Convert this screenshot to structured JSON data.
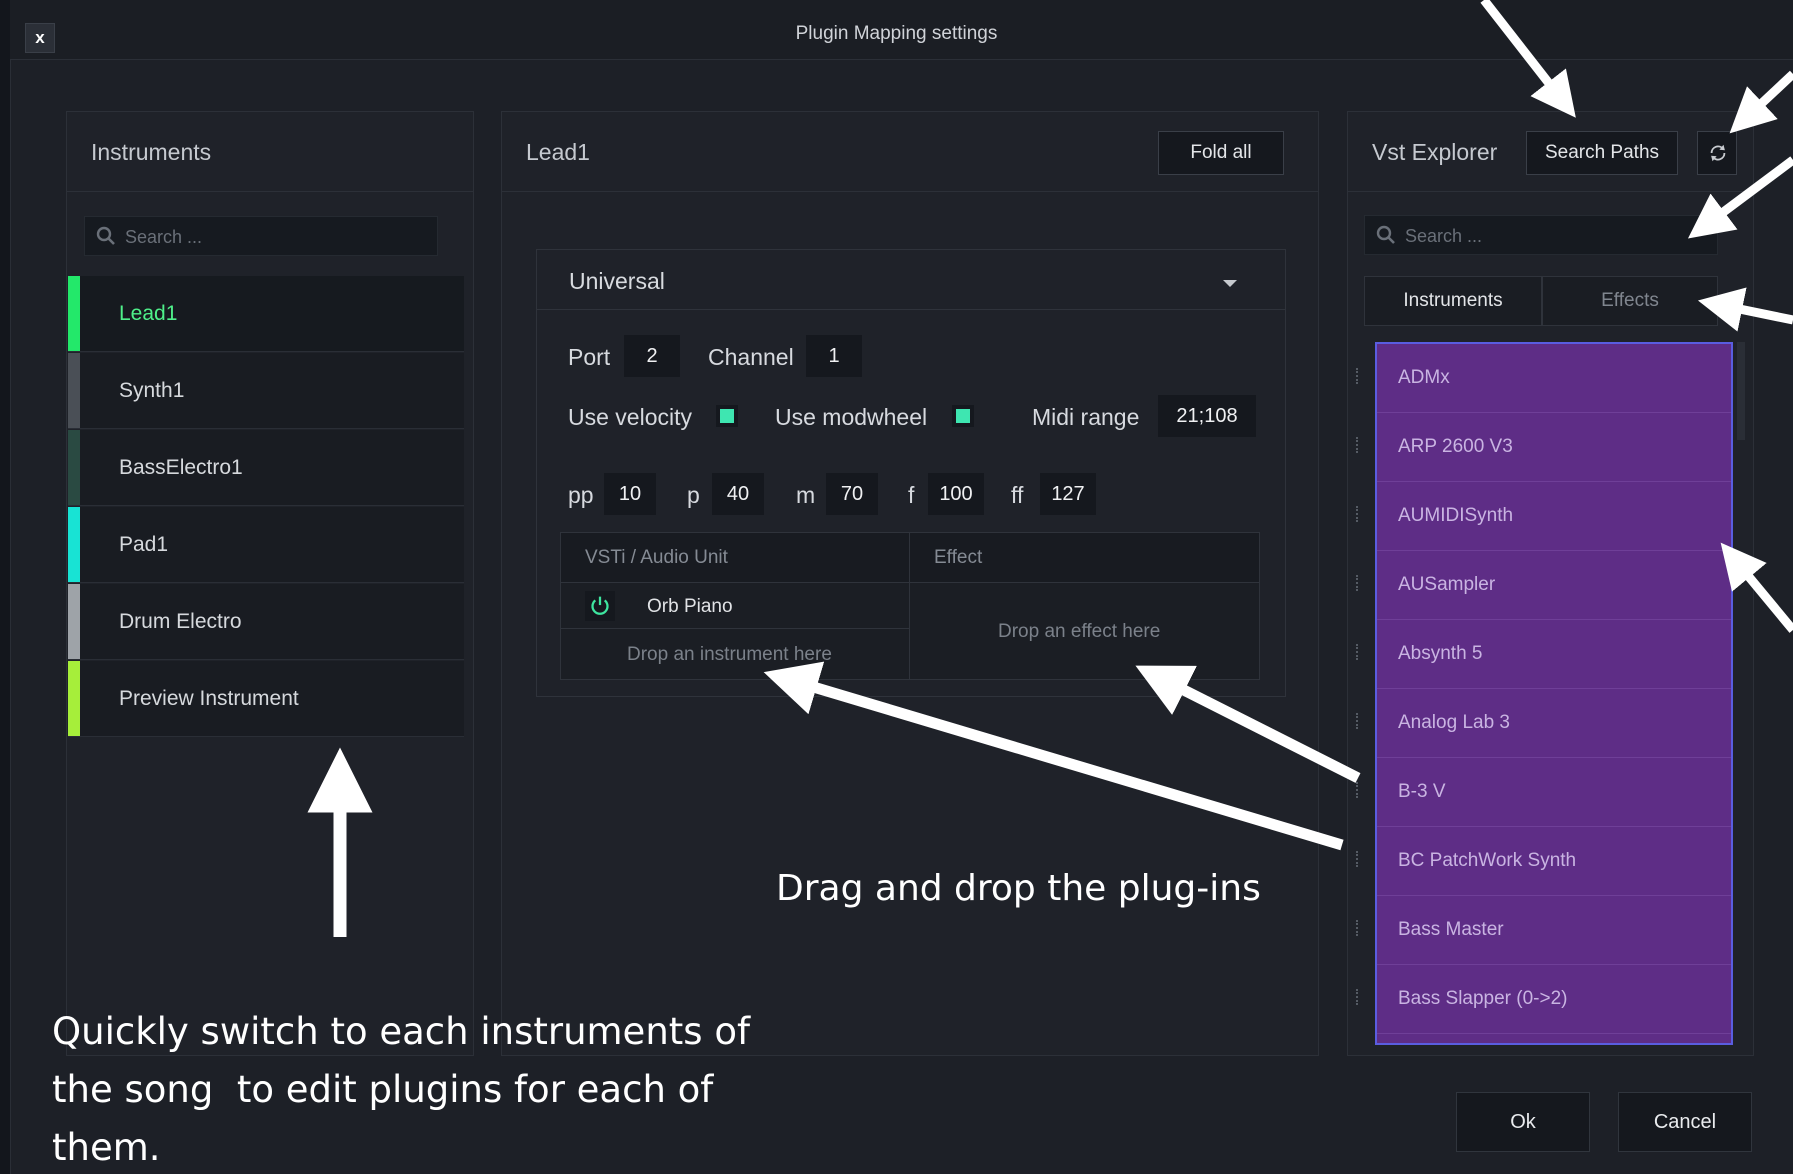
{
  "window": {
    "title": "Plugin Mapping settings",
    "close_label": "x"
  },
  "instruments_panel": {
    "title": "Instruments",
    "search_placeholder": "Search ...",
    "items": [
      {
        "label": "Lead1",
        "color": "#23e86a",
        "selected": true
      },
      {
        "label": "Synth1",
        "color": "#4a4f56"
      },
      {
        "label": "BassElectro1",
        "color": "#2a4a42"
      },
      {
        "label": "Pad1",
        "color": "#18e3d4"
      },
      {
        "label": "Drum Electro",
        "color": "#9ea3a8"
      },
      {
        "label": "Preview Instrument",
        "color": "#a6ee3a"
      }
    ]
  },
  "mapping_panel": {
    "title": "Lead1",
    "fold_all_label": "Fold all",
    "section": {
      "selected": "Universal",
      "port_label": "Port",
      "port_value": "2",
      "channel_label": "Channel",
      "channel_value": "1",
      "use_velocity_label": "Use velocity",
      "use_modwheel_label": "Use modwheel",
      "midi_range_label": "Midi range",
      "midi_range_value": "21;108",
      "dynamics": [
        {
          "label": "pp",
          "value": "10"
        },
        {
          "label": "p",
          "value": "40"
        },
        {
          "label": "m",
          "value": "70"
        },
        {
          "label": "f",
          "value": "100"
        },
        {
          "label": "ff",
          "value": "127"
        }
      ],
      "instrument_col_header": "VSTi / Audio Unit",
      "effect_col_header": "Effect",
      "instrument_name": "Orb Piano",
      "drop_instrument_text": "Drop an instrument here",
      "drop_effect_text": "Drop an effect here"
    }
  },
  "vst_panel": {
    "title": "Vst Explorer",
    "search_paths_label": "Search Paths",
    "search_placeholder": "Search ...",
    "tabs": [
      {
        "label": "Instruments",
        "active": true
      },
      {
        "label": "Effects",
        "active": false
      }
    ],
    "items": [
      "ADMx",
      "ARP 2600 V3",
      "AUMIDISynth",
      "AUSampler",
      "Absynth 5",
      "Analog Lab 3",
      "B-3 V",
      "BC PatchWork Synth",
      "Bass Master",
      "Bass Slapper (0->2)"
    ]
  },
  "footer": {
    "ok_label": "Ok",
    "cancel_label": "Cancel"
  },
  "annotations": {
    "drag_drop": "Drag and drop the plug-ins",
    "switch_line1": "Quickly switch to each instruments of",
    "switch_line2": "the song  to edit plugins for each of",
    "switch_line3": "them."
  }
}
